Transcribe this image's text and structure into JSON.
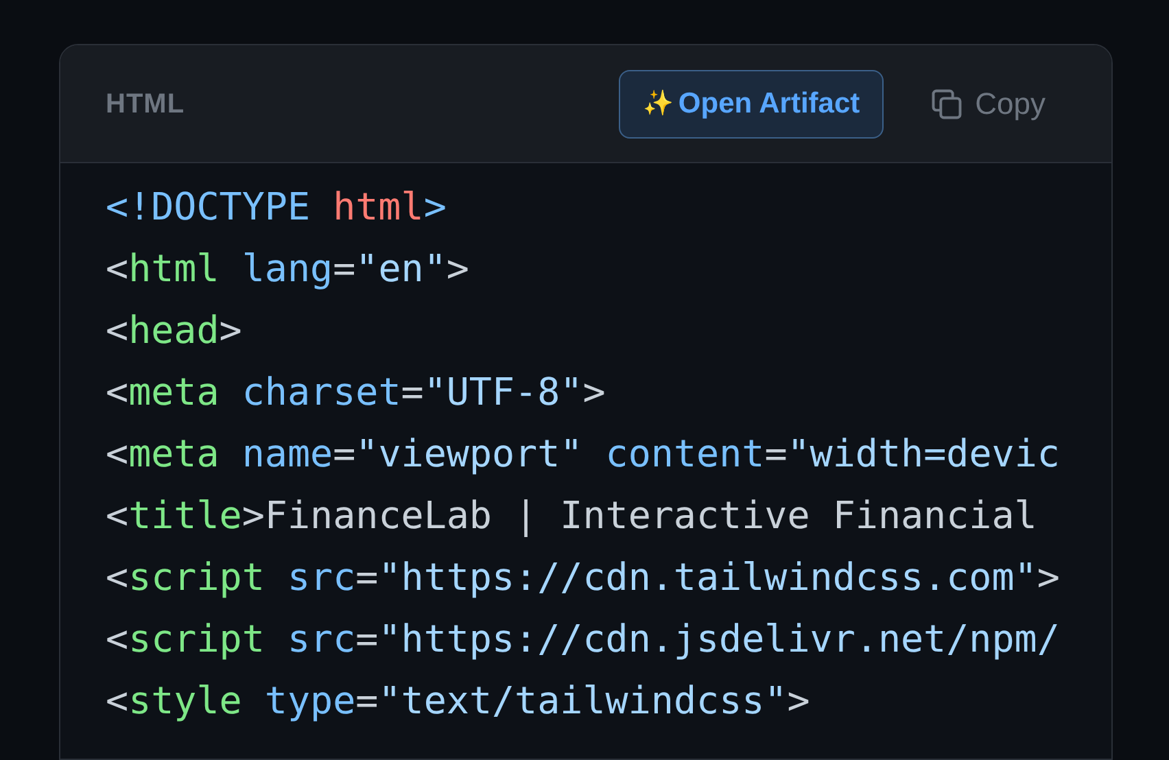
{
  "code_block": {
    "language": "HTML",
    "open_button": {
      "icon": "✨",
      "label": "Open Artifact"
    },
    "copy_button": {
      "label": "Copy"
    },
    "lines": [
      [
        {
          "kind": "punct-blue",
          "text": "<!DOCTYPE"
        },
        {
          "kind": "keyword",
          "text": "html",
          "space_before": true
        },
        {
          "kind": "punct-blue",
          "text": ">"
        }
      ],
      [
        {
          "kind": "punct",
          "text": "<"
        },
        {
          "kind": "tag",
          "text": "html"
        },
        {
          "kind": "attr",
          "text": "lang",
          "space_before": true
        },
        {
          "kind": "punct",
          "text": "="
        },
        {
          "kind": "string",
          "text": "\"en\""
        },
        {
          "kind": "punct",
          "text": ">"
        }
      ],
      [
        {
          "kind": "punct",
          "text": "<"
        },
        {
          "kind": "tag",
          "text": "head"
        },
        {
          "kind": "punct",
          "text": ">"
        }
      ],
      [
        {
          "kind": "punct",
          "text": "<"
        },
        {
          "kind": "tag",
          "text": "meta"
        },
        {
          "kind": "attr",
          "text": "charset",
          "space_before": true
        },
        {
          "kind": "punct",
          "text": "="
        },
        {
          "kind": "string",
          "text": "\"UTF-8\""
        },
        {
          "kind": "punct",
          "text": ">"
        }
      ],
      [
        {
          "kind": "punct",
          "text": "<"
        },
        {
          "kind": "tag",
          "text": "meta"
        },
        {
          "kind": "attr",
          "text": "name",
          "space_before": true
        },
        {
          "kind": "punct",
          "text": "="
        },
        {
          "kind": "string",
          "text": "\"viewport\""
        },
        {
          "kind": "attr",
          "text": "content",
          "space_before": true
        },
        {
          "kind": "punct",
          "text": "="
        },
        {
          "kind": "string",
          "text": "\"width=devic"
        }
      ],
      [
        {
          "kind": "punct",
          "text": "<"
        },
        {
          "kind": "tag",
          "text": "title"
        },
        {
          "kind": "punct",
          "text": ">"
        },
        {
          "kind": "plain",
          "text": "FinanceLab | Interactive Financial"
        }
      ],
      [
        {
          "kind": "punct",
          "text": "<"
        },
        {
          "kind": "tag",
          "text": "script"
        },
        {
          "kind": "attr",
          "text": "src",
          "space_before": true
        },
        {
          "kind": "punct",
          "text": "="
        },
        {
          "kind": "string",
          "text": "\"https://cdn.tailwindcss.com\""
        },
        {
          "kind": "punct",
          "text": ">"
        }
      ],
      [
        {
          "kind": "punct",
          "text": "<"
        },
        {
          "kind": "tag",
          "text": "script"
        },
        {
          "kind": "attr",
          "text": "src",
          "space_before": true
        },
        {
          "kind": "punct",
          "text": "="
        },
        {
          "kind": "string",
          "text": "\"https://cdn.jsdelivr.net/npm/"
        }
      ],
      [
        {
          "kind": "punct",
          "text": "<"
        },
        {
          "kind": "tag",
          "text": "style"
        },
        {
          "kind": "attr",
          "text": "type",
          "space_before": true
        },
        {
          "kind": "punct",
          "text": "="
        },
        {
          "kind": "string",
          "text": "\"text/tailwindcss\""
        },
        {
          "kind": "punct",
          "text": ">"
        }
      ]
    ]
  }
}
